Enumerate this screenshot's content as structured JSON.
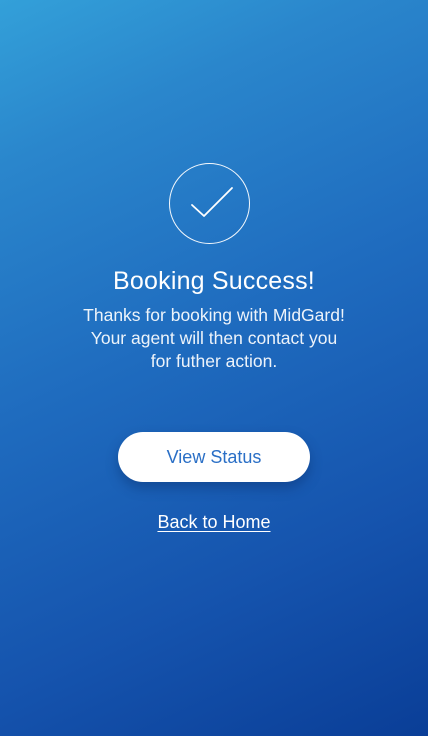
{
  "success": {
    "icon": "checkmark-circle-icon",
    "title": "Booking Success!",
    "message": "Thanks for booking with MidGard!\nYour agent will then contact you\nfor futher action."
  },
  "actions": {
    "view_status_label": "View Status",
    "back_home_label": "Back to Home"
  },
  "colors": {
    "gradient_start": "#33a0d9",
    "gradient_end": "#0a3e97",
    "button_text": "#2a6fc6"
  }
}
